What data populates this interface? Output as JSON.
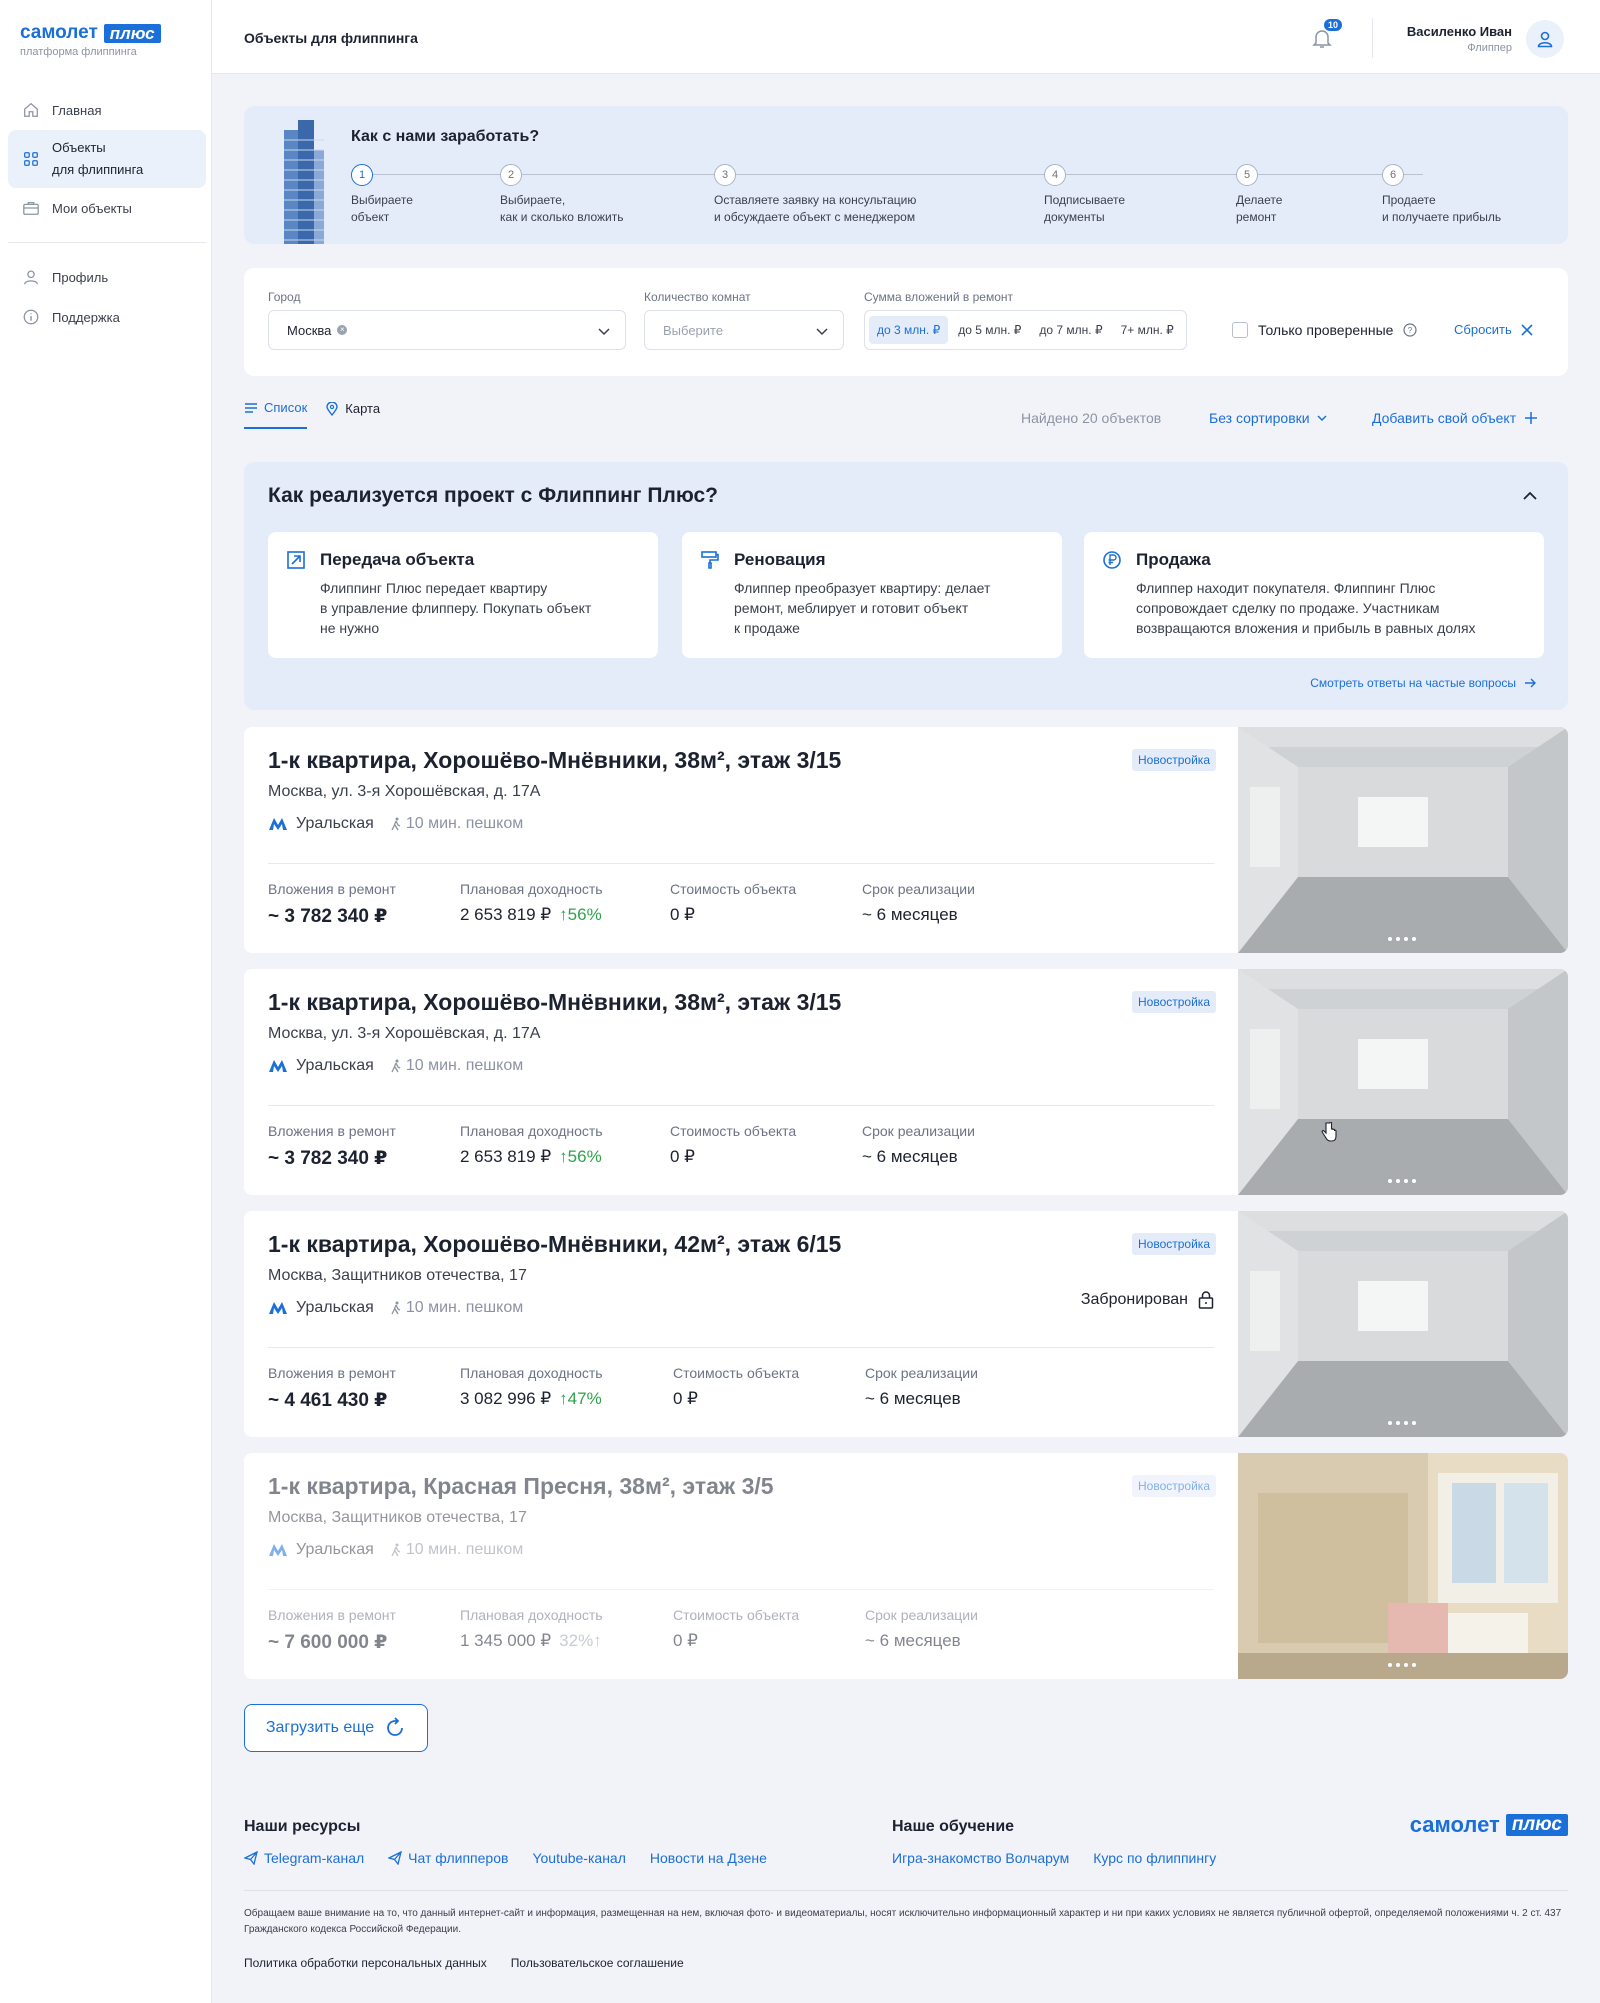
{
  "brand": {
    "name": "самолет",
    "plus": "плюс",
    "subtitle": "платформа флиппинга",
    "accent": "#1b6fd8"
  },
  "sidebar": {
    "items": [
      {
        "label": "Главная",
        "icon": "home-icon"
      },
      {
        "label": "Объекты\nдля флиппинга",
        "icon": "grid-icon",
        "active": true
      },
      {
        "label": "Мои объекты",
        "icon": "briefcase-icon"
      },
      {
        "label": "Профиль",
        "icon": "user-icon"
      },
      {
        "label": "Поддержка",
        "icon": "info-icon"
      }
    ]
  },
  "header": {
    "title": "Объекты для флиппинга",
    "notifications": "10",
    "user_name": "Василенко Иван",
    "user_role": "Флиппер"
  },
  "how": {
    "title": "Как с нами заработать?",
    "steps": [
      {
        "n": "1",
        "text": "Выбираете\nобъект"
      },
      {
        "n": "2",
        "text": "Выбираете,\nкак и сколько вложить"
      },
      {
        "n": "3",
        "text": "Оставляете заявку на консультацию\nи обсуждаете объект с менеджером"
      },
      {
        "n": "4",
        "text": "Подписываете\nдокументы"
      },
      {
        "n": "5",
        "text": "Делаете\nремонт"
      },
      {
        "n": "6",
        "text": "Продаете\nи получаете прибыль"
      }
    ]
  },
  "filters": {
    "city_label": "Город",
    "city_value": "Москва",
    "rooms_label": "Количество комнат",
    "rooms_placeholder": "Выберите",
    "sum_label": "Сумма вложений в ремонт",
    "sum_options": [
      "до 3 млн. ₽",
      "до 5 млн. ₽",
      "до 7 млн. ₽",
      "7+ млн. ₽"
    ],
    "verified_label": "Только проверенные",
    "reset_label": "Сбросить"
  },
  "view": {
    "tab_list": "Список",
    "tab_map": "Карта",
    "found": "Найдено 20 объектов",
    "sort": "Без сортировки",
    "add": "Добавить свой объект"
  },
  "project": {
    "title": "Как реализуется проект с Флиппинг Плюс?",
    "cards": [
      {
        "title": "Передача объекта",
        "text": "Флиппинг Плюс передает квартиру\nв управление флипперу. Покупать объект\nне нужно"
      },
      {
        "title": "Реновация",
        "text": "Флиппер преобразует квартиру: делает\nремонт, меблирует и готовит объект\nк продаже"
      },
      {
        "title": "Продажа",
        "text": "Флиппер находит покупателя. Флиппинг Плюс\nсопровождает сделку по продаже. Участникам\nвозвращаются вложения и прибыль в равных долях"
      }
    ],
    "faq": "Смотреть ответы на частые вопросы"
  },
  "stat_labels": {
    "invest": "Вложения в ремонт",
    "income": "Плановая доходность",
    "cost": "Стоимость объекта",
    "term": "Срок реализации"
  },
  "listings": [
    {
      "title": "1-к квартира, Хорошёво-Мнёвники, 38м², этаж 3/15",
      "address": "Москва, ул. 3-я Хорошёвская, д. 17А",
      "metro": "Уральская",
      "walk": "10 мин. пешком",
      "badge": "Новостройка",
      "invest": "~ 3 782 340 ₽",
      "income": "2 653 819 ₽",
      "income_pct": "↑56%",
      "cost": "0 ₽",
      "term": "~ 6 месяцев"
    },
    {
      "title": "1-к квартира, Хорошёво-Мнёвники, 38м², этаж 3/15",
      "address": "Москва, ул. 3-я Хорошёвская, д. 17А",
      "metro": "Уральская",
      "walk": "10 мин. пешком",
      "badge": "Новостройка",
      "invest": "~ 3 782 340 ₽",
      "income": "2 653 819 ₽",
      "income_pct": "↑56%",
      "cost": "0 ₽",
      "term": "~ 6 месяцев"
    },
    {
      "title": "1-к квартира, Хорошёво-Мнёвники, 42м², этаж 6/15",
      "address": "Москва, Защитников отечества, 17",
      "metro": "Уральская",
      "walk": "10 мин. пешком",
      "badge": "Новостройка",
      "booked": "Забронирован",
      "invest": "~ 4 461 430 ₽",
      "income": "3 082 996 ₽",
      "income_pct": "↑47%",
      "cost": "0 ₽",
      "term": "~ 6 месяцев"
    },
    {
      "title": "1-к квартира, Красная Пресня, 38м², этаж 3/5",
      "address": "Москва, Защитников отечества, 17",
      "metro": "Уральская",
      "walk": "10 мин. пешком",
      "badge": "Новостройка",
      "invest": "~ 7 600 000 ₽",
      "income": "1 345 000 ₽",
      "income_pct": "32%↑",
      "cost": "0 ₽",
      "term": "~ 6 месяцев"
    }
  ],
  "load_more": "Загрузить еще",
  "footer": {
    "resources_title": "Наши ресурсы",
    "resources": [
      "Telegram-канал",
      "Чат флипперов",
      "Youtube-канал",
      "Новости на Дзене"
    ],
    "learning_title": "Наше обучение",
    "learning": [
      "Игра-знакомство Волчарум",
      "Курс по флиппингу"
    ],
    "disclaimer": "Обращаем ваше внимание на то, что данный интернет-сайт и информация, размещенная на нем, включая фото- и видеоматериалы, носят исключительно информационный характер и ни при каких условиях не является публичной офертой, определяемой положениями ч. 2 ст. 437 Гражданского кодекса Российской Федерации.",
    "privacy": "Политика обработки персональных данных",
    "agreement": "Пользовательское соглашение"
  }
}
